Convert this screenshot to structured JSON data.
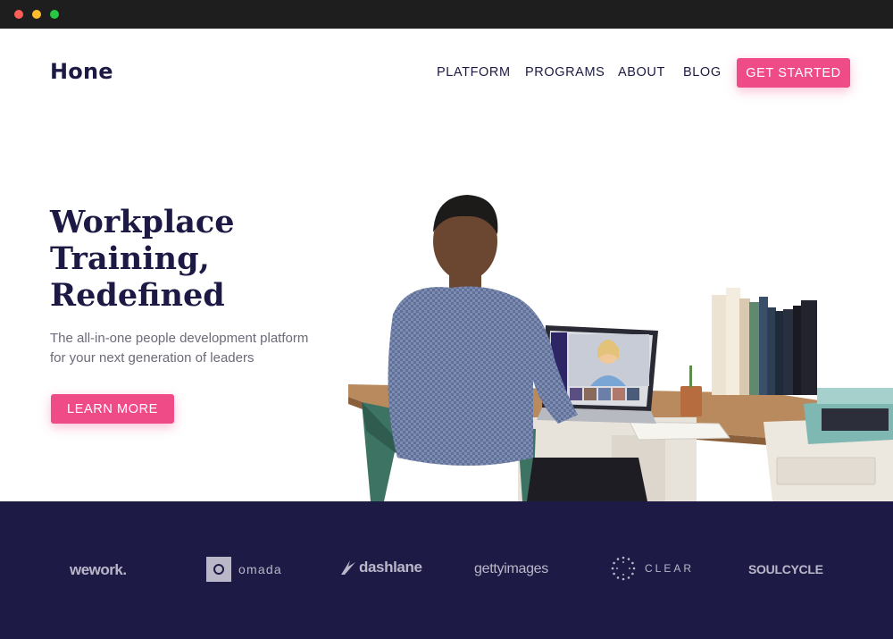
{
  "window": {
    "title": ""
  },
  "header": {
    "logo": "Hone",
    "nav": [
      {
        "label": "PLATFORM"
      },
      {
        "label": "PROGRAMS"
      },
      {
        "label": "ABOUT"
      },
      {
        "label": "BLOG"
      }
    ],
    "cta_label": "GET STARTED"
  },
  "hero": {
    "title_lines": [
      "Workplace",
      "Training,",
      "Redefined"
    ],
    "subtitle_lines": [
      "The all-in-one people development platform",
      "for your next generation of leaders"
    ],
    "button_label": "LEARN MORE",
    "image": "man-at-desk-video-call-photo"
  },
  "logos": {
    "items": [
      {
        "name": "wework."
      },
      {
        "name": "omada"
      },
      {
        "name": "dashlane"
      },
      {
        "name": "gettyimages"
      },
      {
        "name": "CLEAR"
      },
      {
        "name": "SOULCYCLE"
      }
    ]
  },
  "colors": {
    "accent": "#ef4b86",
    "navy": "#1c1a44",
    "band": "#1e1a46",
    "logo_gray": "#b9b7c8"
  }
}
